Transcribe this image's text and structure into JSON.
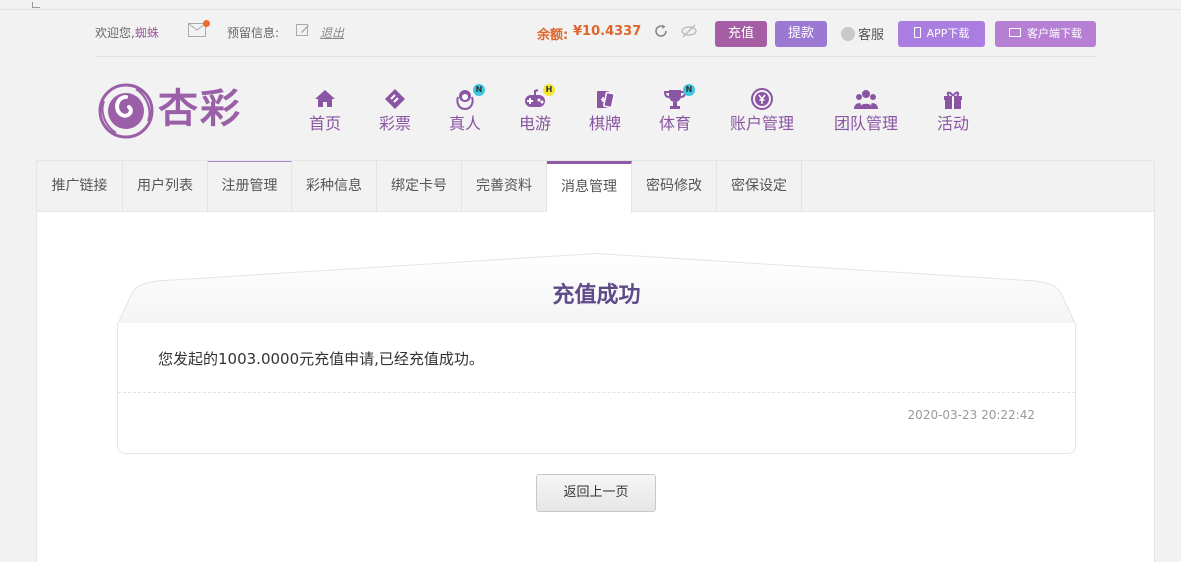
{
  "topbar": {
    "welcome_prefix": "欢迎您,",
    "username": "蜘蛛",
    "reserve_label": "预留信息:",
    "logout_label": "退出",
    "balance_label": "余额:",
    "balance_value": "¥10.4337",
    "recharge_label": "充值",
    "withdraw_label": "提款",
    "service_label": "客服",
    "app_download_label": "APP下载",
    "client_download_label": "客户端下载"
  },
  "logo": {
    "text": "杏彩"
  },
  "nav": {
    "items": [
      {
        "label": "首页",
        "icon": "home-icon"
      },
      {
        "label": "彩票",
        "icon": "ticket-icon"
      },
      {
        "label": "真人",
        "icon": "dealer-icon",
        "badge": "N"
      },
      {
        "label": "电游",
        "icon": "gamepad-icon",
        "badge": "H"
      },
      {
        "label": "棋牌",
        "icon": "cards-icon"
      },
      {
        "label": "体育",
        "icon": "trophy-icon",
        "badge": "N"
      },
      {
        "label": "账户管理",
        "icon": "yen-coin-icon"
      },
      {
        "label": "团队管理",
        "icon": "team-icon"
      },
      {
        "label": "活动",
        "icon": "gift-icon"
      }
    ]
  },
  "tabs": [
    {
      "label": "推广链接"
    },
    {
      "label": "用户列表"
    },
    {
      "label": "注册管理"
    },
    {
      "label": "彩种信息"
    },
    {
      "label": "绑定卡号"
    },
    {
      "label": "完善资料"
    },
    {
      "label": "消息管理"
    },
    {
      "label": "密码修改"
    },
    {
      "label": "密保设定"
    }
  ],
  "message": {
    "title": "充值成功",
    "body": "您发起的1003.0000元充值申请,已经充值成功。",
    "time": "2020-03-23 20:22:42"
  },
  "back_button_label": "返回上一页",
  "colors": {
    "brand_purple": "#8a55a3",
    "balance_orange": "#e0642c",
    "recharge_button": "#a55da4",
    "withdraw_button": "#9b79d2"
  }
}
